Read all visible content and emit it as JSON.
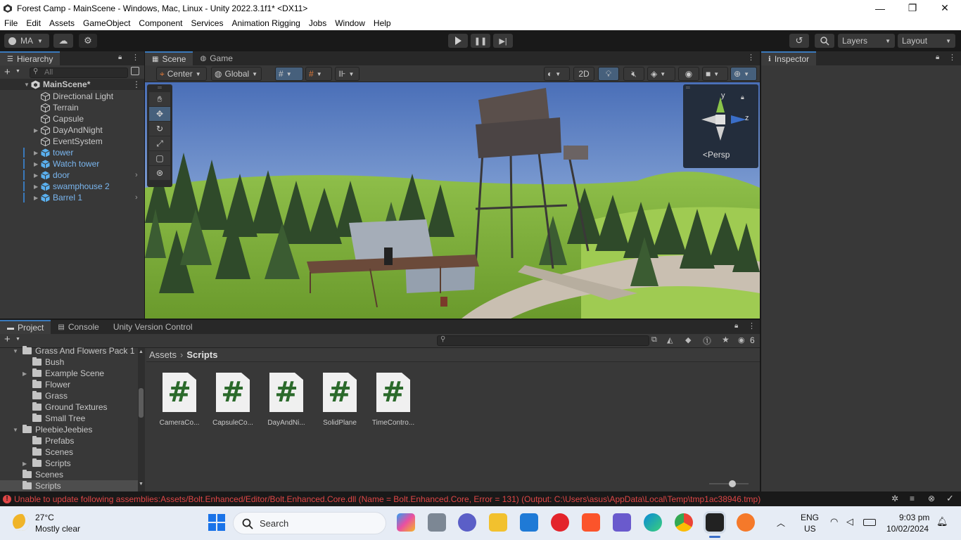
{
  "window": {
    "title": "Forest Camp - MainScene - Windows, Mac, Linux - Unity 2022.3.1f1* <DX11>",
    "minimize": "—",
    "restore": "❐",
    "close": "✕"
  },
  "menu": [
    "File",
    "Edit",
    "Assets",
    "GameObject",
    "Component",
    "Services",
    "Animation Rigging",
    "Jobs",
    "Window",
    "Help"
  ],
  "toolbar": {
    "account": "MA",
    "layers_label": "Layers",
    "layout_label": "Layout"
  },
  "hierarchy": {
    "tab": "Hierarchy",
    "search_placeholder": "All",
    "scene": "MainScene*",
    "items": [
      {
        "label": "Directional Light",
        "expandable": false,
        "prefab": false
      },
      {
        "label": "Terrain",
        "expandable": false,
        "prefab": false
      },
      {
        "label": "Capsule",
        "expandable": false,
        "prefab": false
      },
      {
        "label": "DayAndNight",
        "expandable": true,
        "prefab": false
      },
      {
        "label": "EventSystem",
        "expandable": false,
        "prefab": false
      },
      {
        "label": "tower",
        "expandable": true,
        "prefab": true
      },
      {
        "label": "Watch tower",
        "expandable": true,
        "prefab": true
      },
      {
        "label": "door",
        "expandable": true,
        "prefab": true
      },
      {
        "label": "swamphouse 2",
        "expandable": true,
        "prefab": true
      },
      {
        "label": "Barrel 1",
        "expandable": true,
        "prefab": true
      }
    ]
  },
  "scene": {
    "tabs": [
      "Scene",
      "Game"
    ],
    "pivot": "Center",
    "space": "Global",
    "mode_2d": "2D",
    "gizmo_y": "y",
    "gizmo_z": "z",
    "persp": "Persp"
  },
  "inspector": {
    "tab": "Inspector"
  },
  "project": {
    "tabs": [
      "Project",
      "Console",
      "Unity Version Control"
    ],
    "hidden_count": "6",
    "breadcrumb": [
      "Assets",
      "Scripts"
    ],
    "tree": [
      {
        "label": "Grass And Flowers Pack 1",
        "level": 1,
        "open": true
      },
      {
        "label": "Bush",
        "level": 2,
        "open": false,
        "leaf": true
      },
      {
        "label": "Example Scene",
        "level": 2,
        "open": false,
        "leaf": false
      },
      {
        "label": "Flower",
        "level": 2,
        "open": false,
        "leaf": true
      },
      {
        "label": "Grass",
        "level": 2,
        "open": false,
        "leaf": true
      },
      {
        "label": "Ground Textures",
        "level": 2,
        "open": false,
        "leaf": true
      },
      {
        "label": "Small Tree",
        "level": 2,
        "open": false,
        "leaf": true
      },
      {
        "label": "PleebieJeebies",
        "level": 1,
        "open": true
      },
      {
        "label": "Prefabs",
        "level": 2,
        "open": false,
        "leaf": true
      },
      {
        "label": "Scenes",
        "level": 2,
        "open": false,
        "leaf": true
      },
      {
        "label": "Scripts",
        "level": 2,
        "open": false,
        "leaf": false
      },
      {
        "label": "Scenes",
        "level": 1,
        "open": false,
        "leaf": true
      },
      {
        "label": "Scripts",
        "level": 1,
        "open": false,
        "leaf": true,
        "selected": true
      }
    ],
    "assets": [
      "CameraCo...",
      "CapsuleCo...",
      "DayAndNi...",
      "SolidPlane",
      "TimeContro..."
    ],
    "asset_glyph": "#"
  },
  "status": {
    "error": "Unable to update following assemblies:Assets/Bolt.Enhanced/Editor/Bolt.Enhanced.Core.dll (Name = Bolt.Enhanced.Core, Error = 131) (Output: C:\\Users\\asus\\AppData\\Local\\Temp\\tmp1ac38946.tmp)"
  },
  "taskbar": {
    "weather_temp": "27°C",
    "weather_desc": "Mostly clear",
    "search": "Search",
    "lang1": "ENG",
    "lang2": "US",
    "time": "9:03 pm",
    "date": "10/02/2024"
  },
  "colors": {
    "accent": "#3a79bb",
    "prefab_blue": "#7ab6ef",
    "error_red": "#e04646"
  }
}
